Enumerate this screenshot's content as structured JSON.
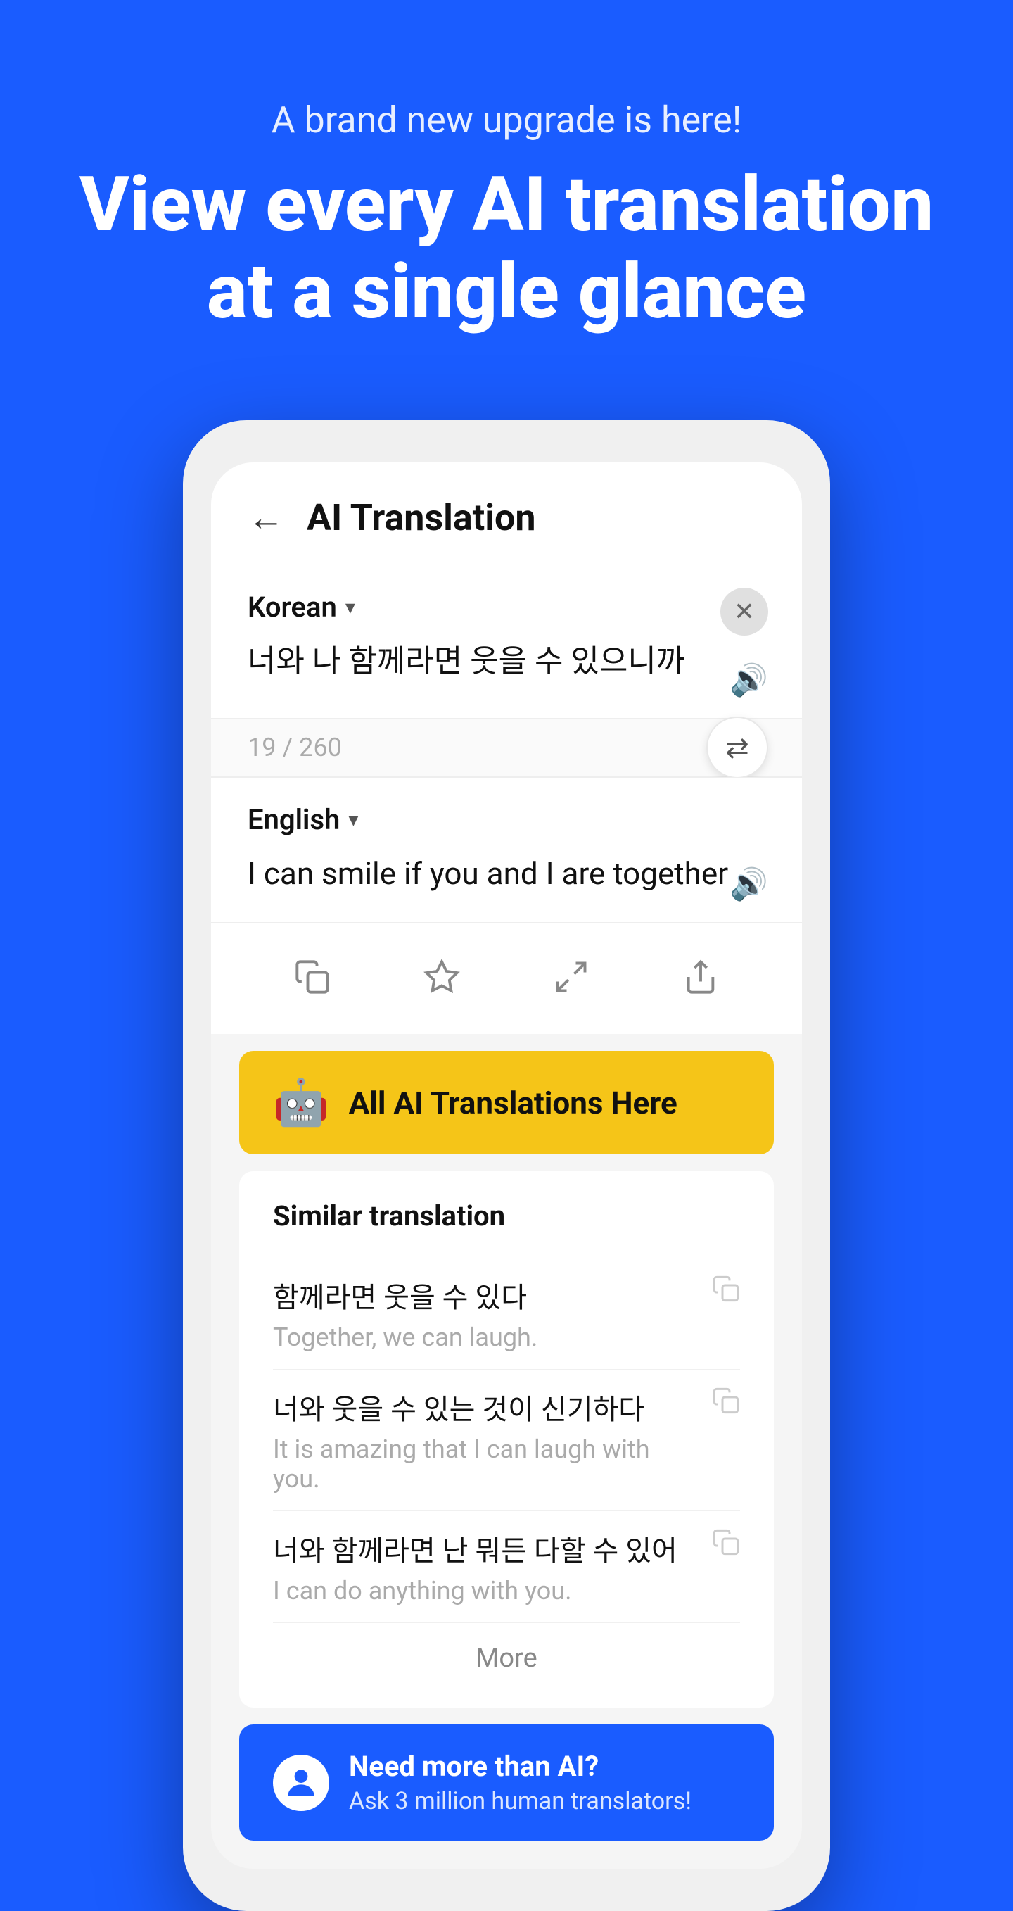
{
  "page": {
    "background_color": "#1a5cff",
    "subtitle": "A brand new upgrade is here!",
    "title_line1": "View every AI translation",
    "title_line2": "at a single glance"
  },
  "header": {
    "back_label": "←",
    "title": "AI Translation"
  },
  "source": {
    "language": "Korean",
    "text": "너와 나 함께라면 웃을 수 있으니까",
    "char_count": "19 / 260"
  },
  "target": {
    "language": "English",
    "text": "I can smile if you and I are together"
  },
  "action_bar": {
    "copy_label": "⊞",
    "star_label": "☆",
    "expand_label": "⤢",
    "share_label": "⬆"
  },
  "ai_banner": {
    "icon": "🤖",
    "label": "All AI Translations Here"
  },
  "similar": {
    "title": "Similar translation",
    "items": [
      {
        "korean": "함께라면 웃을 수 있다",
        "english": "Together, we can laugh."
      },
      {
        "korean": "너와 웃을 수 있는 것이 신기하다",
        "english": "It is amazing that I can laugh with you."
      },
      {
        "korean": "너와 함께라면 난 뭐든 다할 수 있어",
        "english": "I can do anything with you."
      }
    ],
    "more_label": "More"
  },
  "human_banner": {
    "avatar_icon": "🧑",
    "title": "Need more than AI?",
    "subtitle": "Ask 3 million human translators!"
  }
}
